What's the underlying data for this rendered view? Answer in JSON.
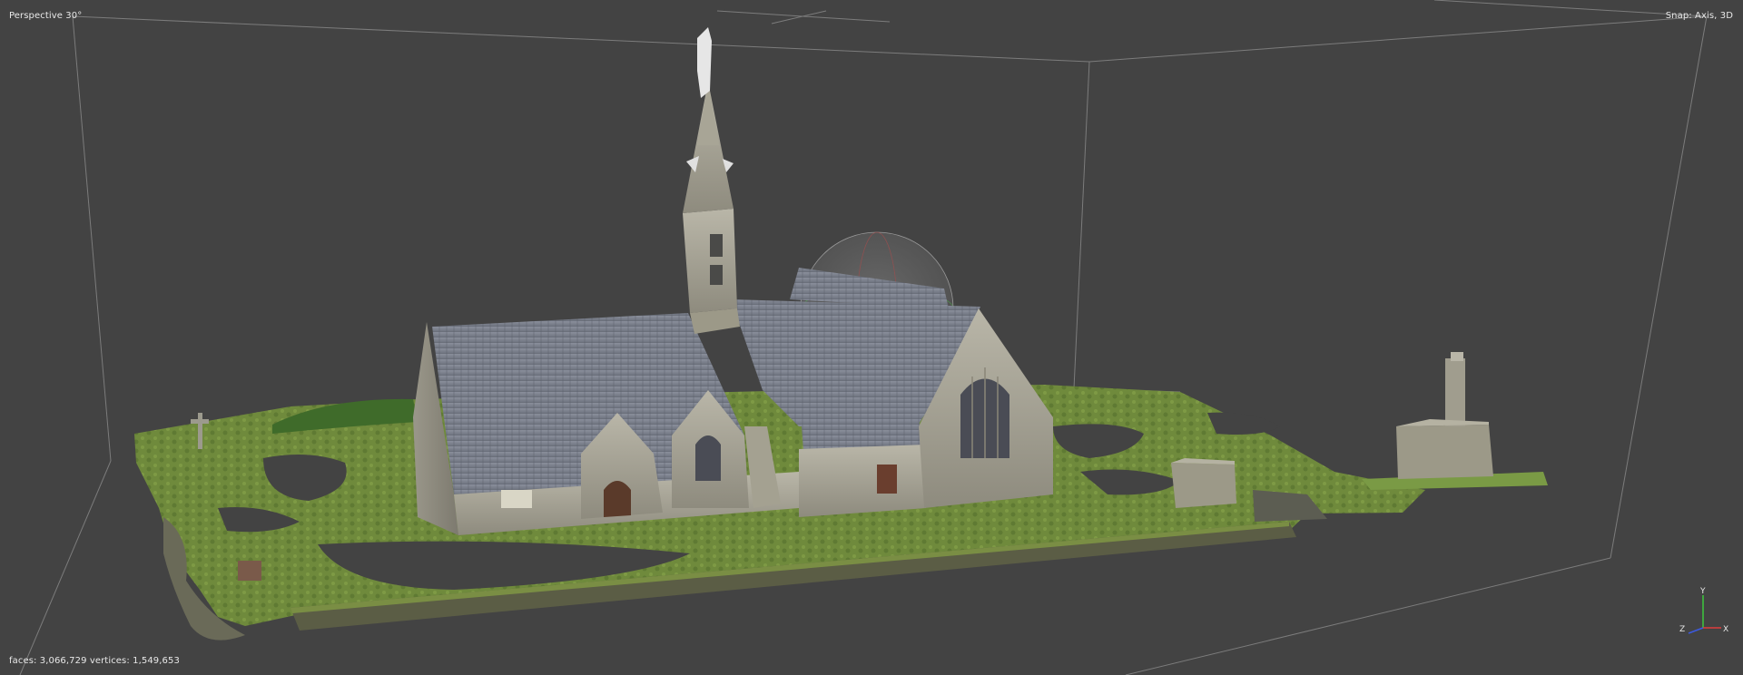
{
  "viewport": {
    "view_label": "Perspective 30°",
    "snap_label": "Snap: Axis, 3D",
    "stats_label": "faces: 3,066,729 vertices: 1,549,653",
    "background": "#434343"
  },
  "axis_gizmo": {
    "x_label": "X",
    "y_label": "Y",
    "z_label": "Z",
    "x_color": "#e03c3c",
    "y_color": "#3cc83c",
    "z_color": "#3c5ae0"
  },
  "scene": {
    "subject": "church-3d-model",
    "icons": [
      "bounding-box",
      "navigation-sphere",
      "axis-gizmo"
    ]
  }
}
